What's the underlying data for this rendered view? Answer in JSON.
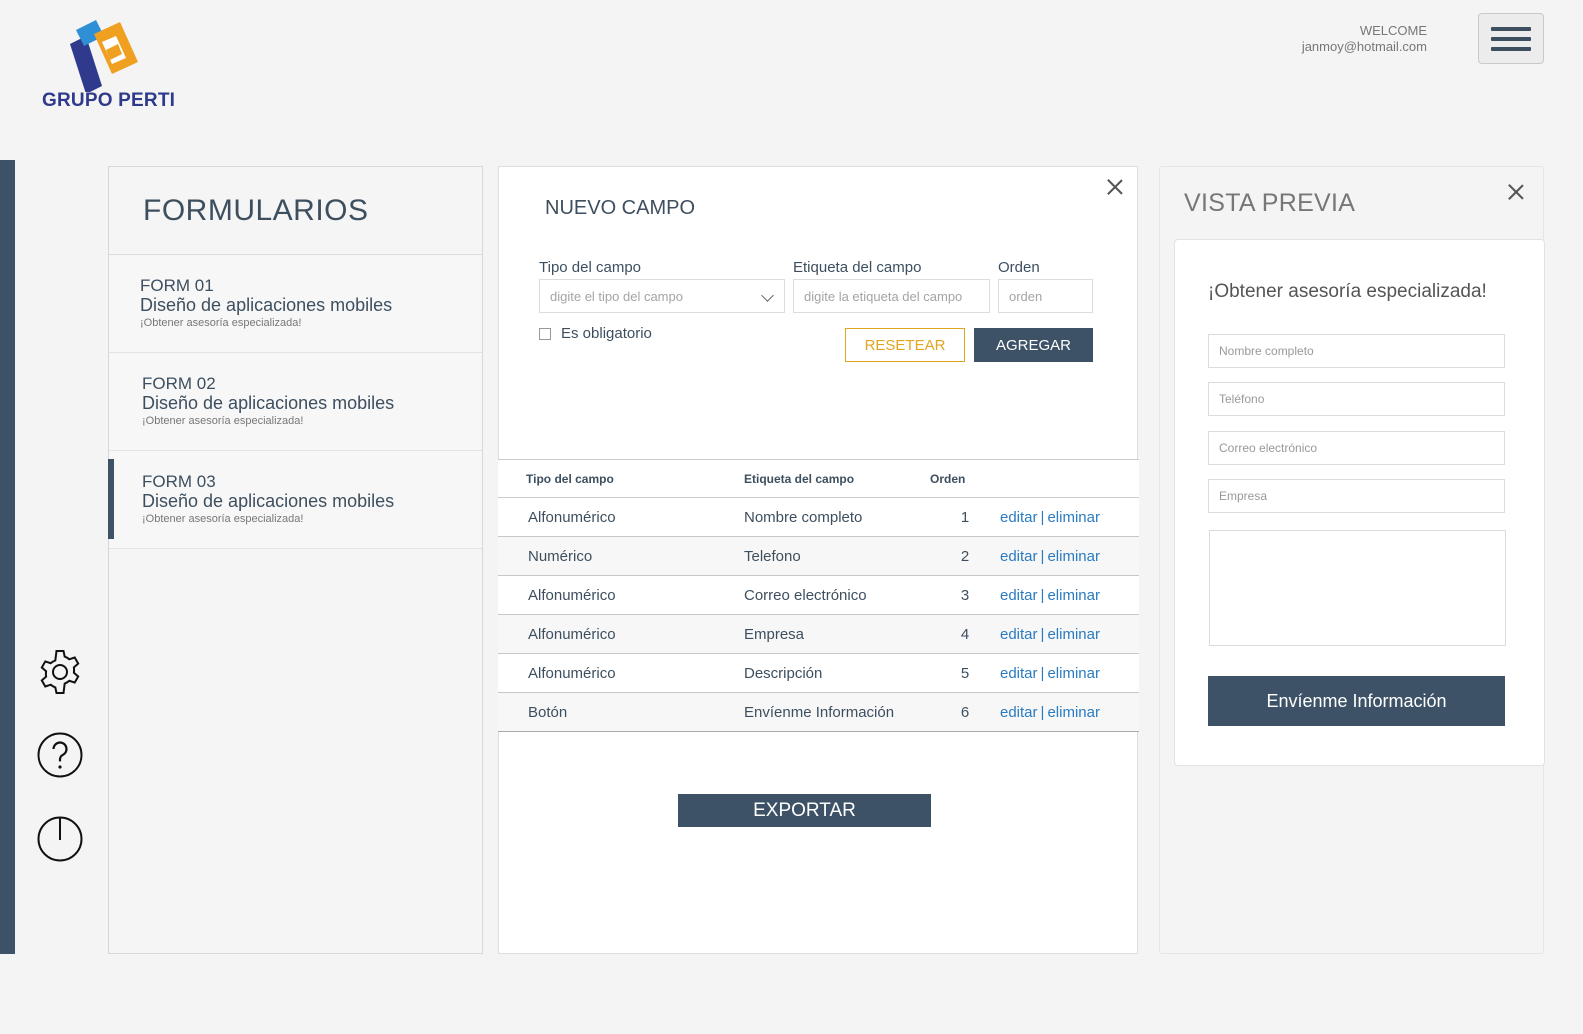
{
  "header": {
    "logo_text": "GRUPO PERTI",
    "welcome_label": "WELCOME",
    "user_email": "janmoy@hotmail.com",
    "menu_icon": "hamburger-menu-icon"
  },
  "sidebar": {
    "icons": [
      "gear-icon",
      "help-icon",
      "power-icon"
    ]
  },
  "forms": {
    "title": "FORMULARIOS",
    "items": [
      {
        "code": "FORM 01",
        "name": "Diseño de aplicaciones mobiles",
        "subtitle": "¡Obtener asesoría  especializada!",
        "active": false
      },
      {
        "code": "FORM 02",
        "name": "Diseño de aplicaciones mobiles",
        "subtitle": "¡Obtener asesoría  especializada!",
        "active": false
      },
      {
        "code": "FORM 03",
        "name": "Diseño de aplicaciones mobiles",
        "subtitle": "¡Obtener asesoría  especializada!",
        "active": true
      }
    ]
  },
  "new_field": {
    "title": "NUEVO CAMPO",
    "type_label": "Tipo del campo",
    "type_placeholder": "digite el tipo del campo",
    "tag_label": "Etiqueta del campo",
    "tag_placeholder": "digite la etiqueta del campo",
    "order_label": "Orden",
    "order_placeholder": "orden",
    "required_label": "Es obligatorio",
    "required_checked": false,
    "reset_label": "RESETEAR",
    "add_label": "AGREGAR",
    "reset_color": "#e2a520",
    "accent_color": "#3d5266"
  },
  "table": {
    "headers": [
      "Tipo del campo",
      "Etiqueta del campo",
      "Orden"
    ],
    "edit_label": "editar",
    "delete_label": "eliminar",
    "link_color": "#2a7bc2",
    "rows": [
      {
        "type": "Alfonumérico",
        "label": "Nombre completo",
        "order": "1"
      },
      {
        "type": "Numérico",
        "label": "Telefono",
        "order": "2"
      },
      {
        "type": "Alfonumérico",
        "label": "Correo electrónico",
        "order": "3"
      },
      {
        "type": "Alfonumérico",
        "label": "Empresa",
        "order": "4"
      },
      {
        "type": "Alfonumérico",
        "label": "Descripción",
        "order": "5"
      },
      {
        "type": "Botón",
        "label": "Envíenme Información",
        "order": "6"
      }
    ]
  },
  "export_label": "EXPORTAR",
  "preview": {
    "title": "VISTA PREVIA",
    "heading": "¡Obtener asesoría  especializada!",
    "fields": [
      {
        "placeholder": "Nombre completo"
      },
      {
        "placeholder": "Teléfono"
      },
      {
        "placeholder": "Correo electrónico"
      },
      {
        "placeholder": "Empresa"
      }
    ],
    "button_label": "Envíenme Información"
  }
}
